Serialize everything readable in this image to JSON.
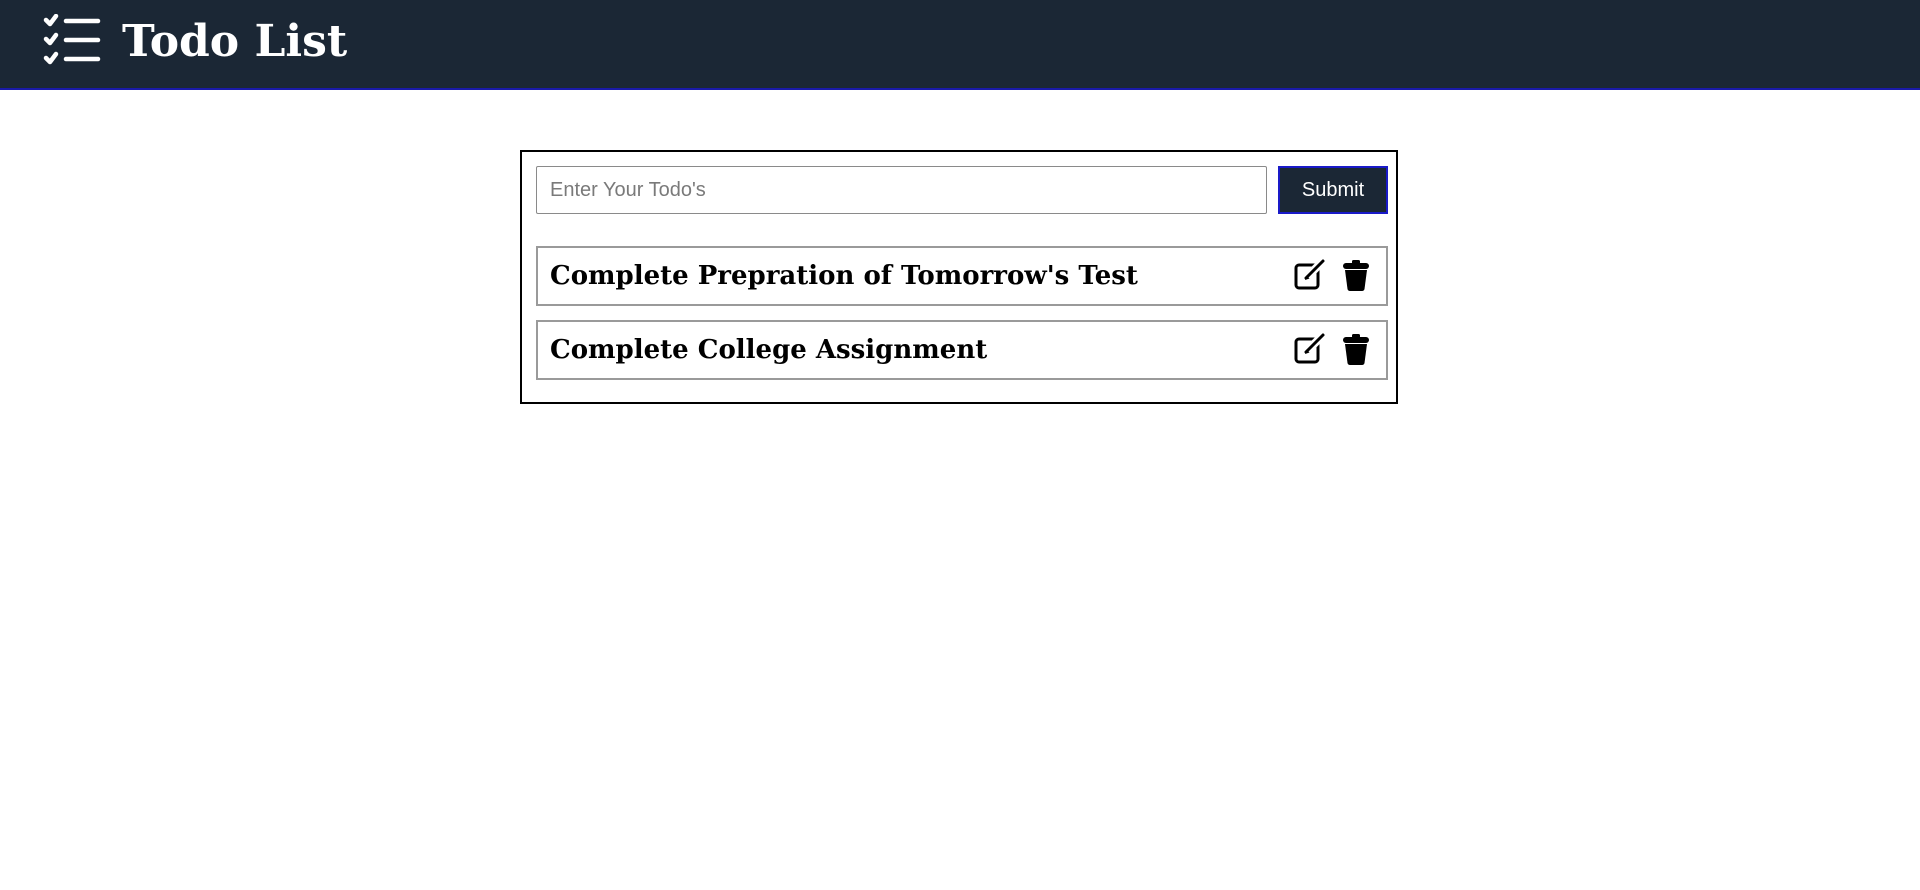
{
  "header": {
    "title": "Todo List",
    "background": "#1b2735",
    "logo_icon": "checklist-icon"
  },
  "form": {
    "placeholder": "Enter Your Todo's",
    "value": "",
    "submit_label": "Submit"
  },
  "todos": [
    {
      "text": "Complete Prepration of Tomorrow's Test",
      "edit_icon": "edit-icon",
      "delete_icon": "trash-icon"
    },
    {
      "text": "Complete College Assignment",
      "edit_icon": "edit-icon",
      "delete_icon": "trash-icon"
    }
  ]
}
